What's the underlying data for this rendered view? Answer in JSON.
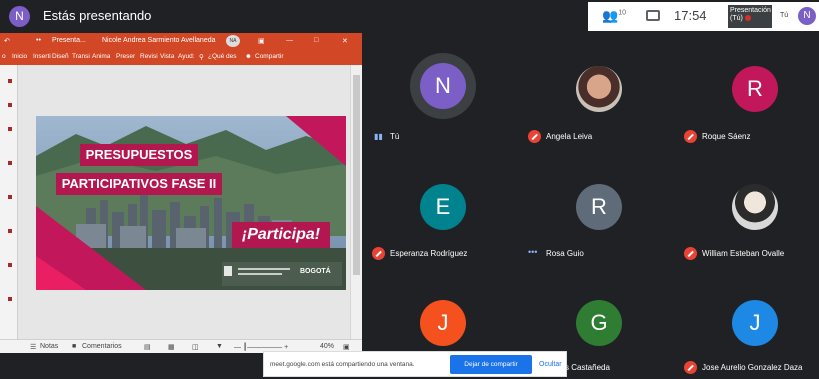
{
  "topbar": {
    "avatar_initial": "N",
    "presenting_title": "Estás presentando",
    "participant_count": "10",
    "time": "17:54",
    "presentation_thumb": "Presentación (Tú)",
    "self_label": "Tú",
    "user_initial": "N",
    "icons": [
      "people-icon",
      "chat-icon"
    ]
  },
  "powerpoint": {
    "title_left": "Presenta...",
    "author": "Nicole Andrea Sarmiento Avellaneda",
    "author_initials": "NA",
    "ribbon_tabs": [
      "Inicio",
      "Inserti",
      "Diseñ",
      "Transi",
      "Anima",
      "Preser",
      "Revisi",
      "Vista",
      "Ayud:"
    ],
    "search_label": "¿Qué des",
    "share_label": "Compartir",
    "status_notes": "Notas",
    "status_comments": "Comentarios",
    "zoom": "40%"
  },
  "slide": {
    "line1": "PRESUPUESTOS",
    "line2": "PARTICIPATIVOS FASE II",
    "cta": "¡Participa!",
    "logo_text": "BOGOTÁ",
    "accent_color": "#b3174f"
  },
  "participants": [
    {
      "initial": "N",
      "name": "Tú",
      "color": "#7b5fc7",
      "speaking": true
    },
    {
      "initial": "",
      "name": "Angela Leiva",
      "color": "#e0a070",
      "muted": true,
      "photo": true
    },
    {
      "initial": "R",
      "name": "Roque Sáenz",
      "color": "#c2185b",
      "muted": true
    },
    {
      "initial": "E",
      "name": "Esperanza Rodríguez",
      "color": "#00838f",
      "muted": true
    },
    {
      "initial": "R",
      "name": "Rosa Guio",
      "color": "#5f6b78",
      "muted": false
    },
    {
      "initial": "",
      "name": "William Esteban Ovalle",
      "color": "#888888",
      "muted": true,
      "photo": true
    },
    {
      "initial": "J",
      "name": "",
      "color": "#f4511e",
      "muted": false
    },
    {
      "initial": "G",
      "name": "s Castañeda",
      "color": "#2e7d32",
      "muted": false
    },
    {
      "initial": "J",
      "name": "Jose Aurelio Gonzalez Daza",
      "color": "#1e88e5",
      "muted": true
    }
  ],
  "share_bar": {
    "message": "meet.google.com está compartiendo una ventana.",
    "stop_button": "Dejar de compartir",
    "hide_button": "Ocultar"
  }
}
